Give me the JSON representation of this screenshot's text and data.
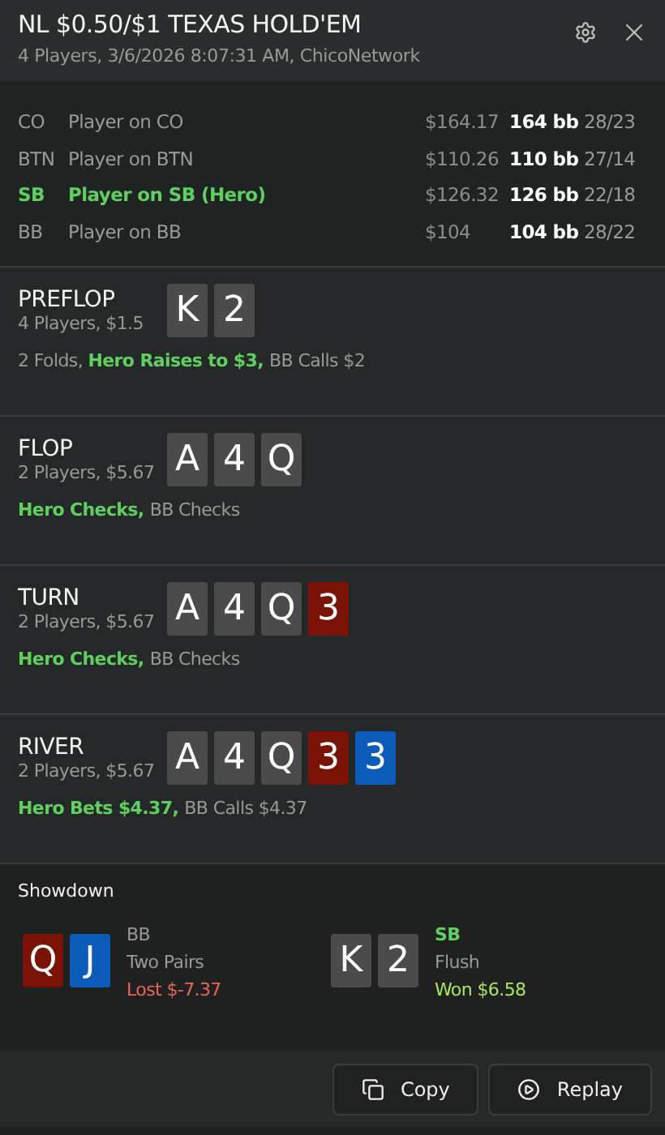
{
  "header": {
    "title": "NL $0.50/$1 TEXAS HOLD'EM",
    "subtitle": "4 Players, 3/6/2026 8:07:31 AM, ChicoNetwork"
  },
  "players": [
    {
      "position": "CO",
      "name": "Player on CO",
      "stack": "$164.17",
      "bb": "164 bb",
      "stats": "28/23",
      "hero": false
    },
    {
      "position": "BTN",
      "name": "Player on BTN",
      "stack": "$110.26",
      "bb": "110 bb",
      "stats": "27/14",
      "hero": false
    },
    {
      "position": "SB",
      "name": "Player on SB (Hero)",
      "stack": "$126.32",
      "bb": "126 bb",
      "stats": "22/18",
      "hero": true
    },
    {
      "position": "BB",
      "name": "Player on BB",
      "stack": "$104",
      "bb": "104 bb",
      "stats": "28/22",
      "hero": false
    }
  ],
  "streets": [
    {
      "name": "PREFLOP",
      "info": "4 Players, $1.5",
      "cards": [
        {
          "rank": "K",
          "color": "#4b4b4b"
        },
        {
          "rank": "2",
          "color": "#4b4b4b"
        }
      ],
      "actions": [
        {
          "text": "2 Folds, ",
          "hero": false
        },
        {
          "text": "Hero Raises to $3, ",
          "hero": true
        },
        {
          "text": "BB Calls $2",
          "hero": false
        }
      ]
    },
    {
      "name": "FLOP",
      "info": "2 Players, $5.67",
      "cards": [
        {
          "rank": "A",
          "color": "#4b4b4b"
        },
        {
          "rank": "4",
          "color": "#4b4b4b"
        },
        {
          "rank": "Q",
          "color": "#4b4b4b"
        }
      ],
      "actions": [
        {
          "text": "Hero Checks, ",
          "hero": true
        },
        {
          "text": "BB Checks",
          "hero": false
        }
      ]
    },
    {
      "name": "TURN",
      "info": "2 Players, $5.67",
      "cards": [
        {
          "rank": "A",
          "color": "#4b4b4b"
        },
        {
          "rank": "4",
          "color": "#4b4b4b"
        },
        {
          "rank": "Q",
          "color": "#4b4b4b"
        },
        {
          "rank": "3",
          "color": "#7a1206"
        }
      ],
      "actions": [
        {
          "text": "Hero Checks, ",
          "hero": true
        },
        {
          "text": "BB Checks",
          "hero": false
        }
      ]
    },
    {
      "name": "RIVER",
      "info": "2 Players, $5.67",
      "cards": [
        {
          "rank": "A",
          "color": "#4b4b4b"
        },
        {
          "rank": "4",
          "color": "#4b4b4b"
        },
        {
          "rank": "Q",
          "color": "#4b4b4b"
        },
        {
          "rank": "3",
          "color": "#7a1206"
        },
        {
          "rank": "3",
          "color": "#0a5cb8"
        }
      ],
      "actions": [
        {
          "text": "Hero Bets $4.37, ",
          "hero": true
        },
        {
          "text": "BB Calls $4.37",
          "hero": false
        }
      ]
    }
  ],
  "showdown": {
    "title": "Showdown",
    "hands": [
      {
        "position": "BB",
        "hero": false,
        "hand": "Two Pairs",
        "result": "Lost $-7.37",
        "won": false,
        "cards": [
          {
            "rank": "Q",
            "color": "#7a1206"
          },
          {
            "rank": "J",
            "color": "#0a5cb8"
          }
        ]
      },
      {
        "position": "SB",
        "hero": true,
        "hand": "Flush",
        "result": "Won $6.58",
        "won": true,
        "cards": [
          {
            "rank": "K",
            "color": "#4b4b4b"
          },
          {
            "rank": "2",
            "color": "#4b4b4b"
          }
        ]
      }
    ]
  },
  "buttons": [
    {
      "label": "Copy",
      "kind": "copy"
    },
    {
      "label": "Replay",
      "kind": "replay"
    }
  ]
}
